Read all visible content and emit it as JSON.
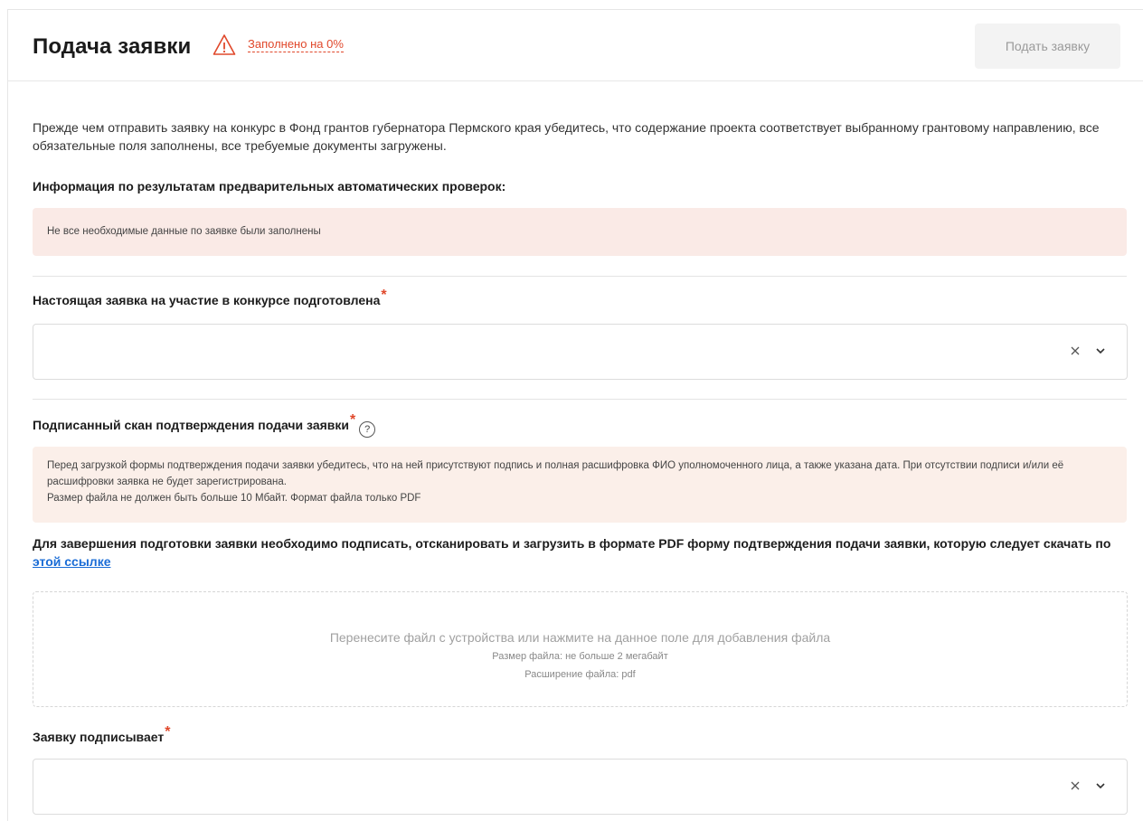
{
  "header": {
    "title": "Подача заявки",
    "fill_status": "Заполнено на 0%",
    "submit_label": "Подать заявку"
  },
  "intro": {
    "text": "Прежде чем отправить заявку на конкурс в Фонд грантов губернатора Пермского края убедитесь, что содержание проекта соответствует выбранному грантовому направлению, все обязательные поля заполнены, все требуемые документы загружены."
  },
  "checks": {
    "title": "Информация по результатам предварительных автоматических проверок:",
    "alert": "Не все необходимые данные по заявке были заполнены"
  },
  "field_prepared": {
    "label": "Настоящая заявка на участие в конкурсе подготовлена",
    "required_mark": "*",
    "value": ""
  },
  "field_scan": {
    "label": "Подписанный скан подтверждения подачи заявки",
    "required_mark": "*",
    "help_glyph": "?",
    "note_line1": "Перед загрузкой формы подтверждения подачи заявки убедитесь, что на ней присутствуют подпись и полная расшифровка ФИО уполномоченного лица, а также указана дата. При отсутствии подписи и/или её расшифровки заявка не будет зарегистрирована.",
    "note_line2": "Размер файла не должен быть больше 10 Мбайт. Формат файла только PDF",
    "instruction": "Для завершения подготовки заявки необходимо подписать, отсканировать и загрузить в формате PDF форму подтверждения подачи заявки, которую следует скачать по",
    "link_text": "этой ссылке",
    "dropzone": {
      "main": "Перенесите файл с устройства или нажмите на данное поле для добавления файла",
      "size": "Размер файла: не больше 2 мегабайт",
      "ext": "Расширение файла: pdf"
    }
  },
  "field_signer": {
    "label": "Заявку подписывает",
    "required_mark": "*",
    "value": ""
  },
  "colors": {
    "accent_red": "#e0482b",
    "alert_bg": "#faeae6",
    "link_blue": "#1a6cd6"
  },
  "icons": {
    "warning": "warning-triangle-icon",
    "clear": "close-icon",
    "chevron": "chevron-down-icon",
    "help": "help-circle-icon"
  }
}
